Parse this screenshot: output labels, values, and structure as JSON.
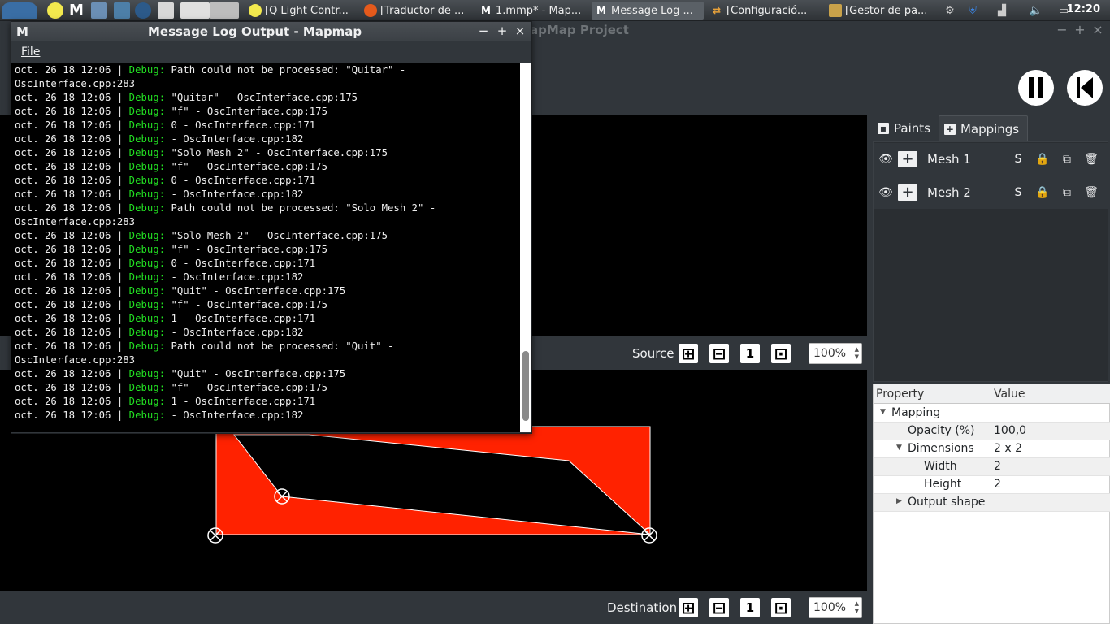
{
  "taskbar": {
    "tasks": [
      {
        "label": "[Q Light Contr..."
      },
      {
        "label": "[Traductor de ..."
      },
      {
        "label": "1.mmp* - Map..."
      },
      {
        "label": "Message Log ..."
      },
      {
        "label": "[Configuració..."
      },
      {
        "label": "[Gestor de pa..."
      }
    ],
    "clock": "12:20"
  },
  "main_window": {
    "title": "MapMap Project",
    "title_visible": "apMap Project"
  },
  "source_view": {
    "label": "Source",
    "zoom": "100%"
  },
  "destination_view": {
    "label": "Destination",
    "zoom": "100%"
  },
  "right_panel": {
    "tabs": [
      {
        "label": "Paints"
      },
      {
        "label": "Mappings"
      }
    ],
    "mappings": [
      {
        "name": "Mesh 1",
        "solo_label": "S"
      },
      {
        "name": "Mesh 2",
        "solo_label": "S"
      }
    ],
    "properties": {
      "header_property": "Property",
      "header_value": "Value",
      "rows": [
        {
          "key": "Mapping",
          "value": ""
        },
        {
          "key": "Opacity (%)",
          "value": "100,0"
        },
        {
          "key": "Dimensions",
          "value": "2 x 2"
        },
        {
          "key": "Width",
          "value": "2"
        },
        {
          "key": "Height",
          "value": "2"
        },
        {
          "key": "Output shape",
          "value": ""
        }
      ]
    }
  },
  "log_window": {
    "title": "Message Log Output - Mapmap",
    "menu_file": "File",
    "lines": [
      {
        "ts": "oct. 26 18 12:06 | ",
        "lvl": "Debug:",
        "msg": " Path could not be processed: \"Quitar\" -"
      },
      {
        "ts": "",
        "lvl": "",
        "msg": "OscInterface.cpp:283"
      },
      {
        "ts": "oct. 26 18 12:06 | ",
        "lvl": "Debug:",
        "msg": " \"Quitar\" - OscInterface.cpp:175"
      },
      {
        "ts": "oct. 26 18 12:06 | ",
        "lvl": "Debug:",
        "msg": " \"f\" - OscInterface.cpp:175"
      },
      {
        "ts": "oct. 26 18 12:06 | ",
        "lvl": "Debug:",
        "msg": " 0 - OscInterface.cpp:171"
      },
      {
        "ts": "oct. 26 18 12:06 | ",
        "lvl": "Debug:",
        "msg": " - OscInterface.cpp:182"
      },
      {
        "ts": "oct. 26 18 12:06 | ",
        "lvl": "Debug:",
        "msg": " \"Solo Mesh 2\" - OscInterface.cpp:175"
      },
      {
        "ts": "oct. 26 18 12:06 | ",
        "lvl": "Debug:",
        "msg": " \"f\" - OscInterface.cpp:175"
      },
      {
        "ts": "oct. 26 18 12:06 | ",
        "lvl": "Debug:",
        "msg": " 0 - OscInterface.cpp:171"
      },
      {
        "ts": "oct. 26 18 12:06 | ",
        "lvl": "Debug:",
        "msg": " - OscInterface.cpp:182"
      },
      {
        "ts": "oct. 26 18 12:06 | ",
        "lvl": "Debug:",
        "msg": " Path could not be processed: \"Solo Mesh 2\" -"
      },
      {
        "ts": "",
        "lvl": "",
        "msg": "OscInterface.cpp:283"
      },
      {
        "ts": "oct. 26 18 12:06 | ",
        "lvl": "Debug:",
        "msg": " \"Solo Mesh 2\" - OscInterface.cpp:175"
      },
      {
        "ts": "oct. 26 18 12:06 | ",
        "lvl": "Debug:",
        "msg": " \"f\" - OscInterface.cpp:175"
      },
      {
        "ts": "oct. 26 18 12:06 | ",
        "lvl": "Debug:",
        "msg": " 0 - OscInterface.cpp:171"
      },
      {
        "ts": "oct. 26 18 12:06 | ",
        "lvl": "Debug:",
        "msg": " - OscInterface.cpp:182"
      },
      {
        "ts": "oct. 26 18 12:06 | ",
        "lvl": "Debug:",
        "msg": " \"Quit\" - OscInterface.cpp:175"
      },
      {
        "ts": "oct. 26 18 12:06 | ",
        "lvl": "Debug:",
        "msg": " \"f\" - OscInterface.cpp:175"
      },
      {
        "ts": "oct. 26 18 12:06 | ",
        "lvl": "Debug:",
        "msg": " 1 - OscInterface.cpp:171"
      },
      {
        "ts": "oct. 26 18 12:06 | ",
        "lvl": "Debug:",
        "msg": " - OscInterface.cpp:182"
      },
      {
        "ts": "oct. 26 18 12:06 | ",
        "lvl": "Debug:",
        "msg": " Path could not be processed: \"Quit\" -"
      },
      {
        "ts": "",
        "lvl": "",
        "msg": "OscInterface.cpp:283"
      },
      {
        "ts": "oct. 26 18 12:06 | ",
        "lvl": "Debug:",
        "msg": " \"Quit\" - OscInterface.cpp:175"
      },
      {
        "ts": "oct. 26 18 12:06 | ",
        "lvl": "Debug:",
        "msg": " \"f\" - OscInterface.cpp:175"
      },
      {
        "ts": "oct. 26 18 12:06 | ",
        "lvl": "Debug:",
        "msg": " 1 - OscInterface.cpp:171"
      },
      {
        "ts": "oct. 26 18 12:06 | ",
        "lvl": "Debug:",
        "msg": " - OscInterface.cpp:182"
      }
    ]
  },
  "colors": {
    "mesh_fill": "#ff2200",
    "debug_text": "#22dd22",
    "panel_bg": "#31363b"
  },
  "icons": {
    "play_pause": "pause-icon",
    "rewind": "skip-back-icon",
    "visibility": "eye-icon",
    "lock": "lock-icon",
    "duplicate": "duplicate-icon",
    "delete": "trash-icon",
    "zoom_in": "zoom-in-icon",
    "zoom_out": "zoom-out-icon",
    "zoom_reset": "zoom-one-icon",
    "zoom_fit": "zoom-fit-icon"
  }
}
